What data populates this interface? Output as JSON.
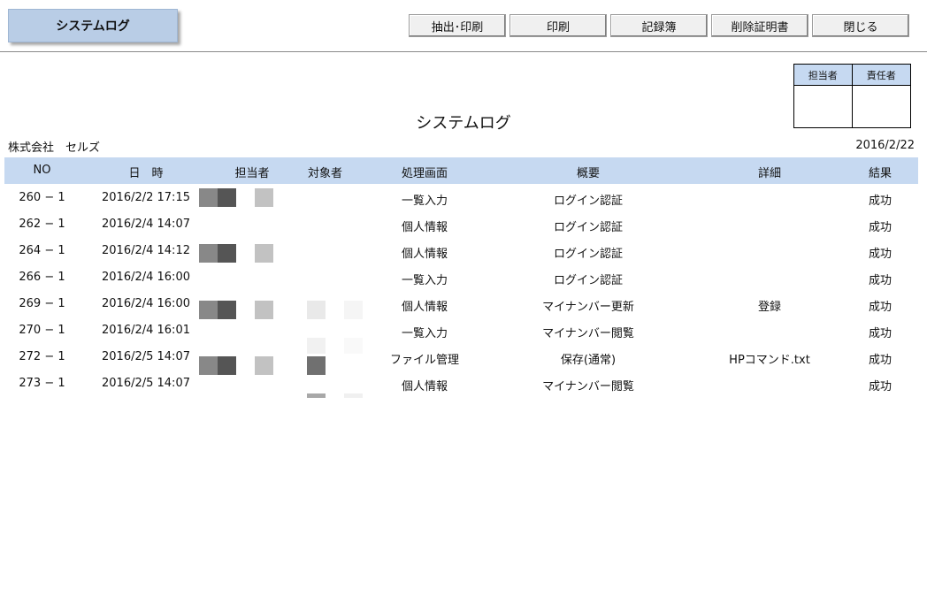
{
  "header": {
    "title": "システムログ"
  },
  "toolbar": {
    "extract_print": "抽出･印刷",
    "print": "印刷",
    "record_book": "記録簿",
    "deletion_certificate": "削除証明書",
    "close": "閉じる"
  },
  "stamp": {
    "tantousha": "担当者",
    "sekininsha": "責任者"
  },
  "report": {
    "title": "システムログ",
    "company": "株式会社　セルズ",
    "date": "2016/2/22"
  },
  "table": {
    "headers": {
      "no": "NO",
      "datetime": "日　時",
      "user": "担当者",
      "target": "対象者",
      "screen": "処理画面",
      "summary": "概要",
      "detail": "詳細",
      "result": "結果"
    },
    "rows": [
      {
        "no": "260 − 1",
        "datetime": "2016/2/2 17:15",
        "screen": "一覧入力",
        "summary": "ログイン認証",
        "detail": "",
        "result": "成功"
      },
      {
        "no": "262 − 1",
        "datetime": "2016/2/4 14:07",
        "screen": "個人情報",
        "summary": "ログイン認証",
        "detail": "",
        "result": "成功"
      },
      {
        "no": "264 − 1",
        "datetime": "2016/2/4 14:12",
        "screen": "個人情報",
        "summary": "ログイン認証",
        "detail": "",
        "result": "成功"
      },
      {
        "no": "266 − 1",
        "datetime": "2016/2/4 16:00",
        "screen": "一覧入力",
        "summary": "ログイン認証",
        "detail": "",
        "result": "成功"
      },
      {
        "no": "269 − 1",
        "datetime": "2016/2/4 16:00",
        "screen": "個人情報",
        "summary": "マイナンバー更新",
        "detail": "登録",
        "result": "成功"
      },
      {
        "no": "270 − 1",
        "datetime": "2016/2/4 16:01",
        "screen": "一覧入力",
        "summary": "マイナンバー閲覧",
        "detail": "",
        "result": "成功"
      },
      {
        "no": "272 − 1",
        "datetime": "2016/2/5 14:07",
        "screen": "ファイル管理",
        "summary": "保存(通常)",
        "detail": "HPコマンド.txt",
        "result": "成功"
      },
      {
        "no": "273 − 1",
        "datetime": "2016/2/5 14:07",
        "screen": "個人情報",
        "summary": "マイナンバー閲覧",
        "detail": "",
        "result": "成功"
      }
    ]
  },
  "colors": {
    "header_blue": "#c6d9f1",
    "title_tab": "#b9cde6"
  }
}
